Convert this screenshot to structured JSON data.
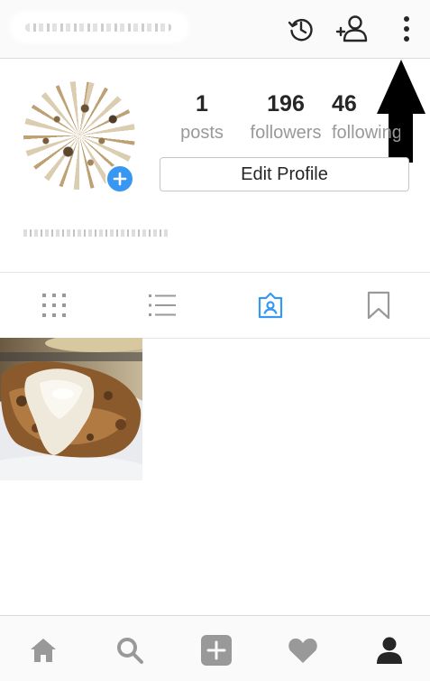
{
  "header": {
    "username_redacted": true,
    "icons": [
      "history-icon",
      "add-person-icon",
      "more-options-icon"
    ]
  },
  "profile": {
    "stats": [
      {
        "value": "1",
        "label": "posts"
      },
      {
        "value": "196",
        "label": "followers"
      },
      {
        "value": "46",
        "label": "following"
      }
    ],
    "edit_button_label": "Edit Profile",
    "bio_redacted": true
  },
  "tabs": [
    {
      "icon": "grid-icon",
      "active": false
    },
    {
      "icon": "list-icon",
      "active": false
    },
    {
      "icon": "tagged-photos-icon",
      "active": true
    },
    {
      "icon": "bookmark-icon",
      "active": false
    }
  ],
  "posts": [
    {
      "description": "plated food photo"
    }
  ],
  "bottom_nav": [
    {
      "icon": "home-icon",
      "active": false
    },
    {
      "icon": "search-icon",
      "active": false
    },
    {
      "icon": "add-post-icon",
      "active": false
    },
    {
      "icon": "heart-icon",
      "active": false
    },
    {
      "icon": "profile-icon",
      "active": true
    }
  ],
  "colors": {
    "accent": "#3897f0",
    "inactive_icon": "#999999",
    "active_icon": "#262626",
    "stat_label": "#999999"
  }
}
